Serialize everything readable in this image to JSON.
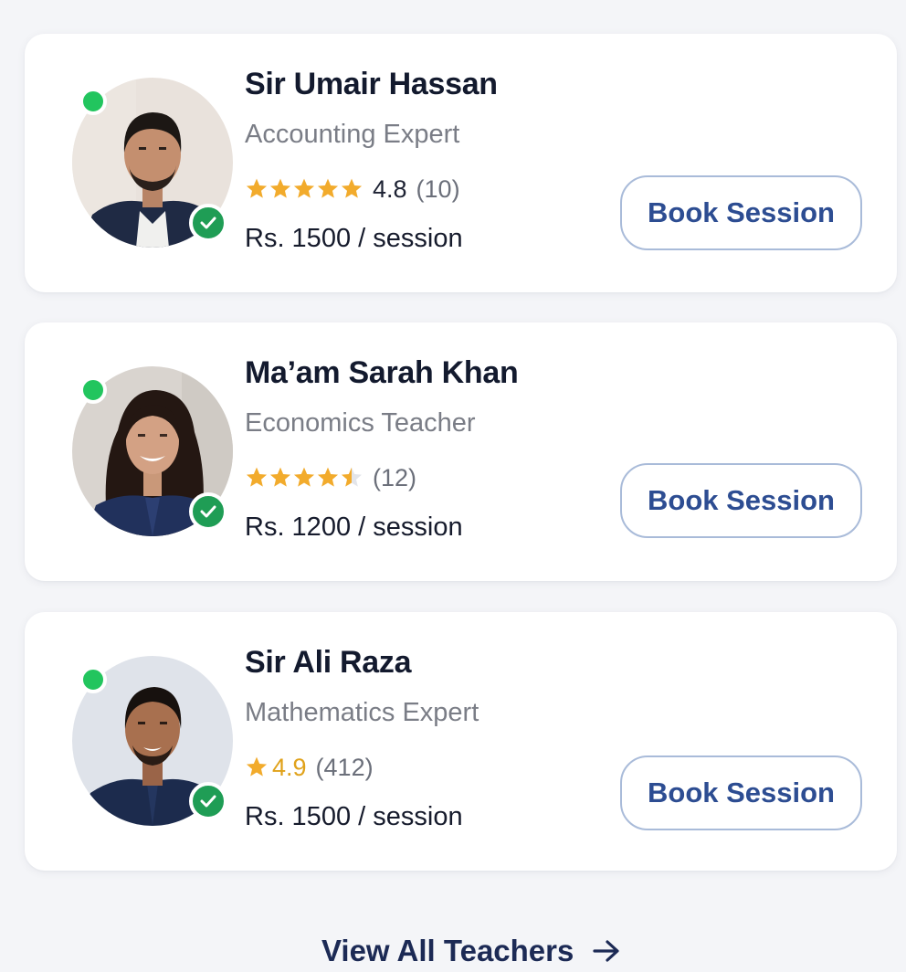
{
  "teachers": [
    {
      "name": "Sir Umair Hassan",
      "subject": "Accounting Expert",
      "stars_filled": 5,
      "rating": "4.8",
      "reviews": "(10)",
      "price": "Rs. 1500 / session",
      "button": "Book Session",
      "online": true,
      "verified": true
    },
    {
      "name": "Ma’am Sarah Khan",
      "subject": "Economics Teacher",
      "stars_filled": 4.5,
      "rating": "",
      "reviews": "(12)",
      "price": "Rs. 1200 / session",
      "button": "Book Session",
      "online": true,
      "verified": true
    },
    {
      "name": "Sir Ali Raza",
      "subject": "Mathematics Expert",
      "stars_filled": 1,
      "rating": "4.9",
      "reviews": "(412)",
      "price": "Rs. 1500 / session",
      "button": "Book Session",
      "online": true,
      "verified": true
    }
  ],
  "footer": {
    "view_all_label": "View All Teachers",
    "view_all_icon": "arrow-right-icon"
  },
  "colors": {
    "star": "#f2ab2c",
    "online": "#22c55e",
    "verified": "#1f9d55",
    "button_text": "#2d4d92",
    "button_border": "#a9bbd9",
    "name": "#131a2e"
  }
}
